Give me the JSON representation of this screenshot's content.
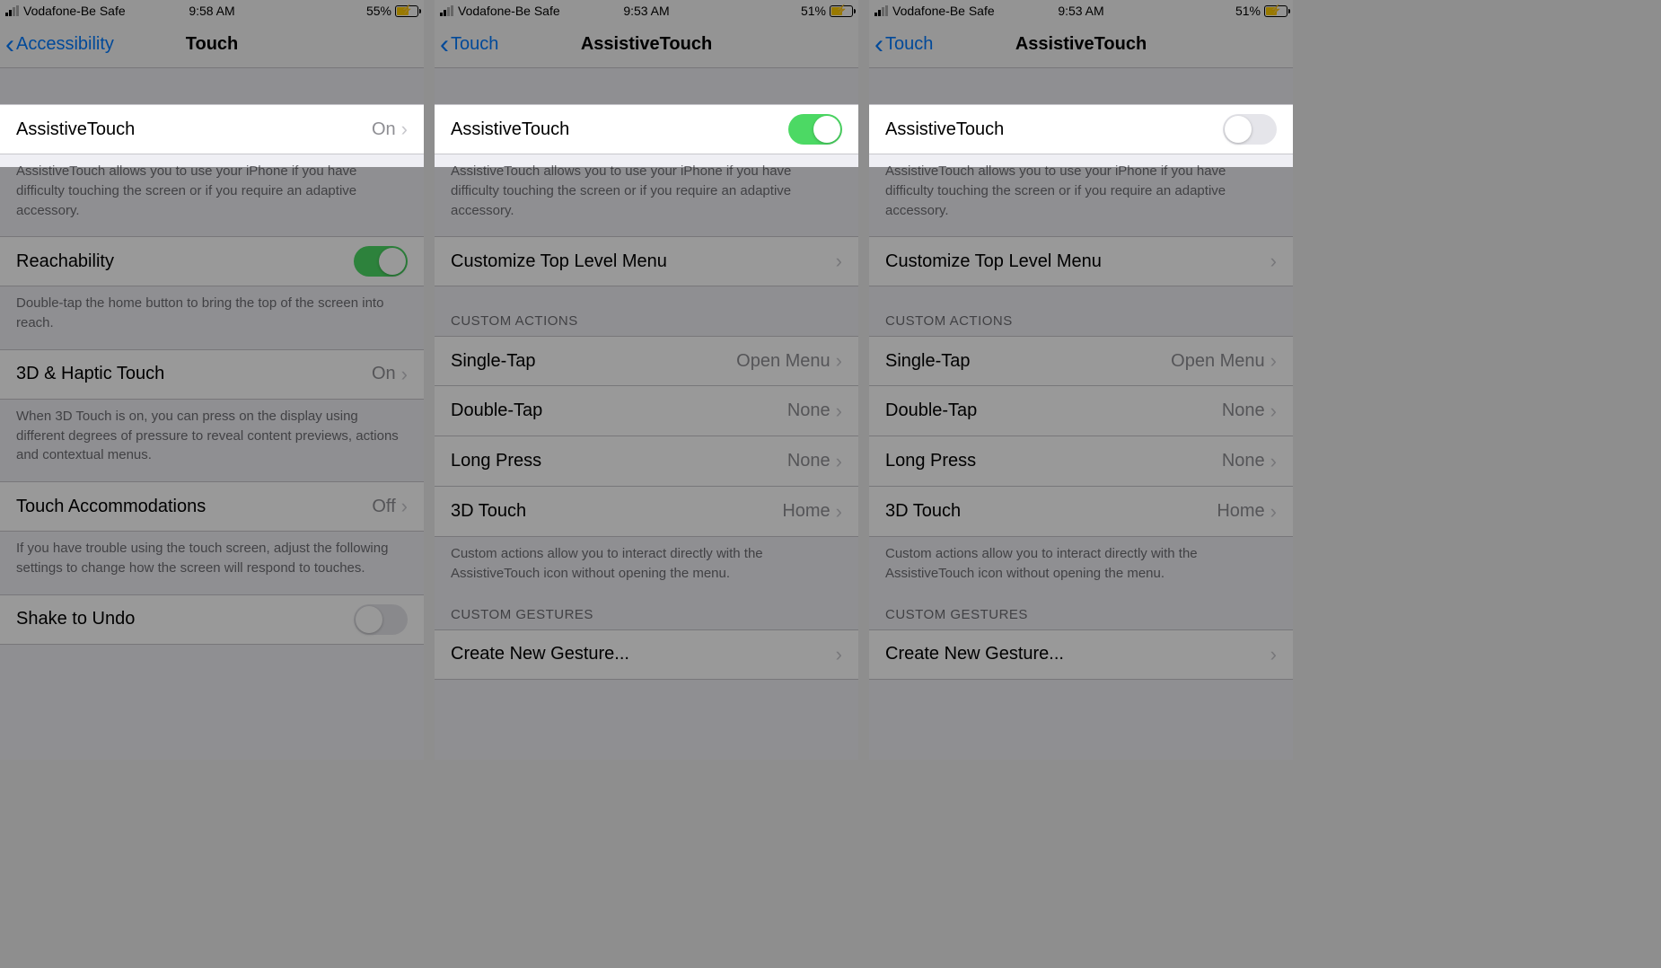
{
  "screens": [
    {
      "status": {
        "carrier": "Vodafone-Be Safe",
        "time": "9:58 AM",
        "battery_pct": "55%",
        "battery_fill": 55
      },
      "nav": {
        "back": "Accessibility",
        "title": "Touch"
      },
      "highlight_row": {
        "label": "AssistiveTouch",
        "value": "On",
        "kind": "disclosure"
      },
      "after_highlight": [
        {
          "type": "footer",
          "text": "AssistiveTouch allows you to use your iPhone if you have difficulty touching the screen or if you require an adaptive accessory."
        },
        {
          "type": "row",
          "label": "Reachability",
          "kind": "switch",
          "on": true
        },
        {
          "type": "footer",
          "text": "Double-tap the home button to bring the top of the screen into reach."
        },
        {
          "type": "row",
          "label": "3D & Haptic Touch",
          "value": "On",
          "kind": "disclosure"
        },
        {
          "type": "footer",
          "text": "When 3D Touch is on, you can press on the display using different degrees of pressure to reveal content previews, actions and contextual menus."
        },
        {
          "type": "row",
          "label": "Touch Accommodations",
          "value": "Off",
          "kind": "disclosure"
        },
        {
          "type": "footer",
          "text": "If you have trouble using the touch screen, adjust the following settings to change how the screen will respond to touches."
        },
        {
          "type": "row",
          "label": "Shake to Undo",
          "kind": "switch",
          "on": false
        }
      ]
    },
    {
      "status": {
        "carrier": "Vodafone-Be Safe",
        "time": "9:53 AM",
        "battery_pct": "51%",
        "battery_fill": 51
      },
      "nav": {
        "back": "Touch",
        "title": "AssistiveTouch"
      },
      "highlight_row": {
        "label": "AssistiveTouch",
        "kind": "switch",
        "on": true
      },
      "after_highlight": [
        {
          "type": "footer",
          "text": "AssistiveTouch allows you to use your iPhone if you have difficulty touching the screen or if you require an adaptive accessory."
        },
        {
          "type": "row",
          "label": "Customize Top Level Menu",
          "kind": "disclosure"
        },
        {
          "type": "header",
          "text": "CUSTOM ACTIONS"
        },
        {
          "type": "row",
          "label": "Single-Tap",
          "value": "Open Menu",
          "kind": "disclosure"
        },
        {
          "type": "row",
          "label": "Double-Tap",
          "value": "None",
          "kind": "disclosure"
        },
        {
          "type": "row",
          "label": "Long Press",
          "value": "None",
          "kind": "disclosure"
        },
        {
          "type": "row",
          "label": "3D Touch",
          "value": "Home",
          "kind": "disclosure"
        },
        {
          "type": "footer",
          "text": "Custom actions allow you to interact directly with the AssistiveTouch icon without opening the menu."
        },
        {
          "type": "header",
          "text": "CUSTOM GESTURES"
        },
        {
          "type": "row",
          "label": "Create New Gesture...",
          "kind": "disclosure"
        }
      ]
    },
    {
      "status": {
        "carrier": "Vodafone-Be Safe",
        "time": "9:53 AM",
        "battery_pct": "51%",
        "battery_fill": 51
      },
      "nav": {
        "back": "Touch",
        "title": "AssistiveTouch"
      },
      "highlight_row": {
        "label": "AssistiveTouch",
        "kind": "switch",
        "on": false
      },
      "after_highlight": [
        {
          "type": "footer",
          "text": "AssistiveTouch allows you to use your iPhone if you have difficulty touching the screen or if you require an adaptive accessory."
        },
        {
          "type": "row",
          "label": "Customize Top Level Menu",
          "kind": "disclosure"
        },
        {
          "type": "header",
          "text": "CUSTOM ACTIONS"
        },
        {
          "type": "row",
          "label": "Single-Tap",
          "value": "Open Menu",
          "kind": "disclosure"
        },
        {
          "type": "row",
          "label": "Double-Tap",
          "value": "None",
          "kind": "disclosure"
        },
        {
          "type": "row",
          "label": "Long Press",
          "value": "None",
          "kind": "disclosure"
        },
        {
          "type": "row",
          "label": "3D Touch",
          "value": "Home",
          "kind": "disclosure"
        },
        {
          "type": "footer",
          "text": "Custom actions allow you to interact directly with the AssistiveTouch icon without opening the menu."
        },
        {
          "type": "header",
          "text": "CUSTOM GESTURES"
        },
        {
          "type": "row",
          "label": "Create New Gesture...",
          "kind": "disclosure"
        }
      ]
    }
  ]
}
